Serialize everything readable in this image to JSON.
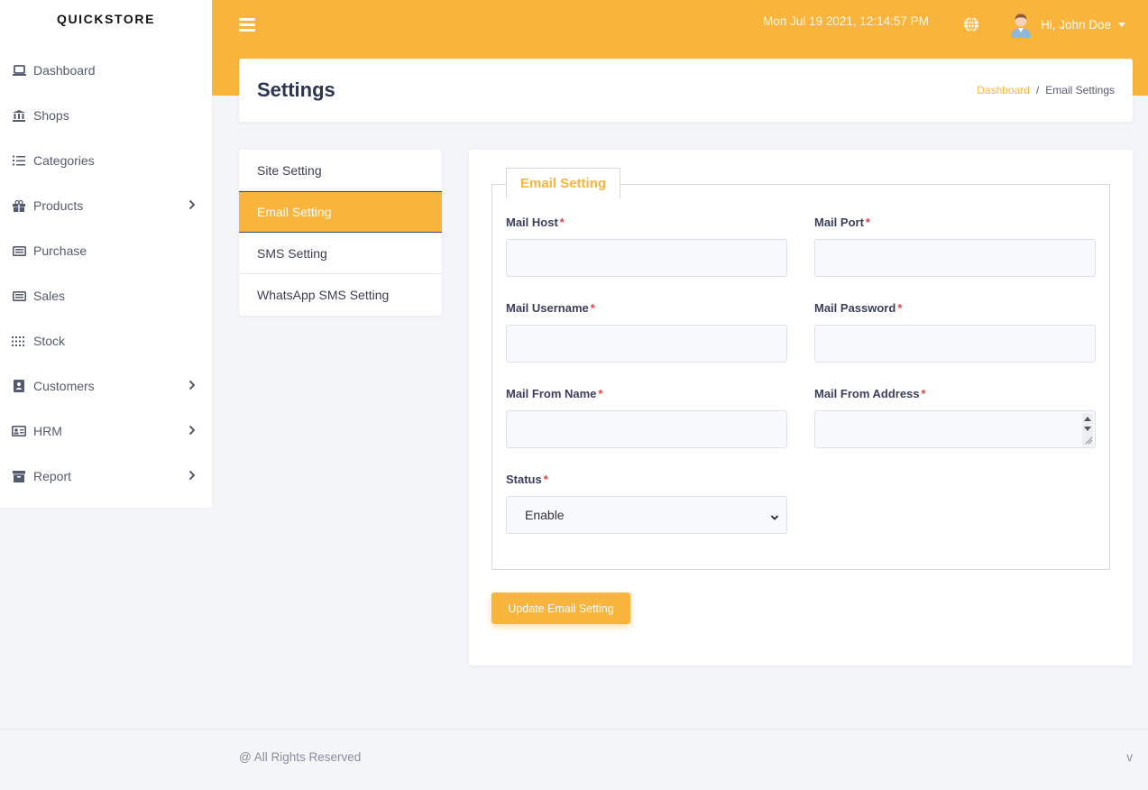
{
  "brand": "QUICKSTORE",
  "sidebar": {
    "items": [
      {
        "label": "Dashboard",
        "icon": "laptop-icon",
        "has_submenu": false
      },
      {
        "label": "Shops",
        "icon": "bank-icon",
        "has_submenu": false
      },
      {
        "label": "Categories",
        "icon": "list-icon",
        "has_submenu": false
      },
      {
        "label": "Products",
        "icon": "gift-icon",
        "has_submenu": true
      },
      {
        "label": "Purchase",
        "icon": "money-icon",
        "has_submenu": false
      },
      {
        "label": "Sales",
        "icon": "money-icon",
        "has_submenu": false
      },
      {
        "label": "Stock",
        "icon": "grid-icon",
        "has_submenu": false
      },
      {
        "label": "Customers",
        "icon": "contact-book-icon",
        "has_submenu": true
      },
      {
        "label": "HRM",
        "icon": "id-card-icon",
        "has_submenu": true
      },
      {
        "label": "Report",
        "icon": "archive-icon",
        "has_submenu": true
      }
    ]
  },
  "header": {
    "datetime": "Mon Jul 19 2021, 12:14:57 PM",
    "user_greeting": "Hi, John Doe"
  },
  "page": {
    "title": "Settings",
    "breadcrumb": {
      "home": "Dashboard",
      "current": "Email Settings"
    }
  },
  "settings_menu": {
    "items": [
      "Site Setting",
      "Email Setting",
      "SMS Setting",
      "WhatsApp SMS Setting"
    ],
    "active_index": 1
  },
  "form": {
    "legend": "Email Setting",
    "fields": {
      "mail_host": {
        "label": "Mail Host",
        "value": ""
      },
      "mail_port": {
        "label": "Mail Port",
        "value": ""
      },
      "mail_username": {
        "label": "Mail Username",
        "value": ""
      },
      "mail_password": {
        "label": "Mail Password",
        "value": ""
      },
      "mail_from_name": {
        "label": "Mail From Name",
        "value": ""
      },
      "mail_from_address": {
        "label": "Mail From Address",
        "value": ""
      },
      "status": {
        "label": "Status",
        "value": "Enable"
      }
    },
    "required_mark": "*",
    "submit_label": "Update Email Setting"
  },
  "footer": {
    "copyright": "@ All Rights Reserved",
    "version": "v"
  },
  "colors": {
    "accent": "#f9b43c",
    "required": "#e0434b",
    "title": "#2c3450"
  }
}
